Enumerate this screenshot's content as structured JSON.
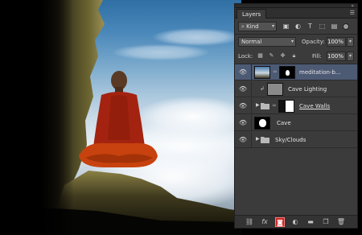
{
  "panel": {
    "tab_label": "Layers",
    "menu_icon": "panel-menu-icon",
    "collapse_icon": "collapse-icon",
    "filter": {
      "kind_label": "Kind",
      "filter_icons": [
        "pixel-filter-icon",
        "adjustment-filter-icon",
        "type-filter-icon",
        "shape-filter-icon",
        "smart-object-filter-icon"
      ]
    },
    "blend_mode": "Normal",
    "opacity_label": "Opacity:",
    "opacity_value": "100%",
    "lock_label": "Lock:",
    "lock_icons": [
      "lock-transparent-pixels-icon",
      "lock-image-pixels-icon",
      "lock-position-icon",
      "lock-all-icon"
    ],
    "fill_label": "Fill:",
    "fill_value": "100%"
  },
  "layers": [
    {
      "name": "meditation-b...",
      "type": "pixel-with-mask",
      "selected": true,
      "visible": true
    },
    {
      "name": "Cave Lighting",
      "type": "clipped-adjustment",
      "selected": false,
      "visible": true
    },
    {
      "name": "Cave Walls",
      "type": "group-with-mask",
      "selected": false,
      "visible": true
    },
    {
      "name": "Cave",
      "type": "pixel",
      "selected": false,
      "visible": true
    },
    {
      "name": "Sky/Clouds",
      "type": "group",
      "selected": false,
      "visible": true
    }
  ],
  "footer_icons": [
    "link-layers-icon",
    "fx-icon",
    "add-mask-icon",
    "adjustment-layer-icon",
    "new-group-icon",
    "new-layer-icon",
    "delete-icon"
  ],
  "footer_fx_label": "fx",
  "colors": {
    "panel_bg": "#3b3b3b",
    "selected_row": "#4d5a74",
    "highlight_red": "#c92323"
  }
}
